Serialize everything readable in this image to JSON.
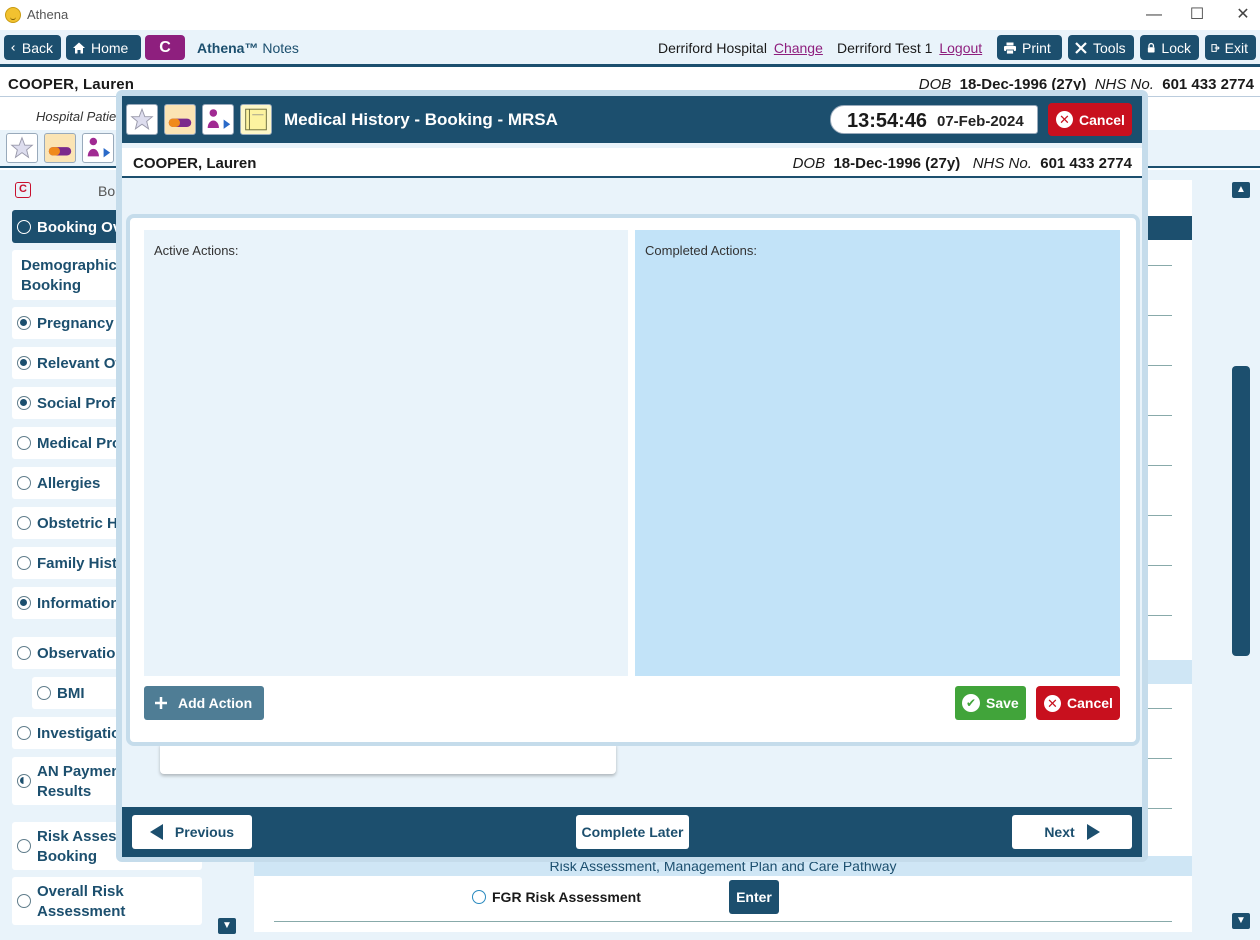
{
  "window": {
    "title": "Athena"
  },
  "toolbar": {
    "back": "Back",
    "home": "Home",
    "c_label": "C",
    "brand_bold": "Athena™",
    "brand_rest": " Notes",
    "hospital": "Derriford Hospital",
    "change": "Change",
    "user": "Derriford Test 1",
    "logout": "Logout",
    "print": "Print",
    "tools": "Tools",
    "lock": "Lock",
    "exit": "Exit"
  },
  "patient": {
    "name": "COOPER, Lauren",
    "dob_label": "DOB",
    "dob": "18-Dec-1996 (27y)",
    "nhs_label": "NHS No.",
    "nhs": "601 433 2774"
  },
  "subbar": {
    "label": "Hospital Patie"
  },
  "sidebar": {
    "header_text": "Bo",
    "items": [
      {
        "label": "Booking Ov",
        "state": "active"
      },
      {
        "label": "Demographics",
        "label2": "Booking",
        "state": "none"
      },
      {
        "label": "Pregnancy P",
        "state": "filled"
      },
      {
        "label": "Relevant Oth",
        "state": "filled"
      },
      {
        "label": "Social Profil",
        "state": "filled"
      },
      {
        "label": "Medical Pro",
        "state": "empty"
      },
      {
        "label": "Allergies",
        "state": "empty"
      },
      {
        "label": "Obstetric Hi",
        "state": "empty"
      },
      {
        "label": "Family Histo",
        "state": "empty"
      },
      {
        "label": "Information",
        "state": "filled"
      },
      {
        "label": "Observation",
        "state": "empty"
      },
      {
        "label": "BMI",
        "state": "empty"
      },
      {
        "label": "Investigation",
        "state": "empty"
      },
      {
        "label": "AN Paymen",
        "label2": "Results",
        "state": "half"
      },
      {
        "label": "Risk Assess",
        "label2": "Booking",
        "state": "empty"
      },
      {
        "label": "Overall Risk",
        "label2": "Assessment",
        "state": "empty"
      }
    ]
  },
  "background": {
    "risk_header": "Risk Assessment, Management Plan and Care Pathway",
    "fgr_label": "FGR Risk Assessment",
    "enter": "Enter"
  },
  "modal": {
    "title": "Medical History - Booking - MRSA",
    "time": "13:54:46",
    "date": "07-Feb-2024",
    "cancel": "Cancel",
    "active_actions": "Active Actions:",
    "completed_actions": "Completed Actions:",
    "add_action": "Add Action",
    "save": "Save",
    "previous": "Previous",
    "complete_later": "Complete Later",
    "next": "Next"
  },
  "colors": {
    "primary": "#1c4f6e",
    "accent_purple": "#8e1f7e",
    "danger": "#c8101e",
    "success": "#41a43a",
    "panel_light": "#e9f3fa",
    "panel_blue": "#c2e3f8"
  },
  "icons": [
    "app-icon",
    "back-chevron-icon",
    "home-icon",
    "print-icon",
    "tools-icon",
    "lock-icon",
    "exit-icon",
    "star-icon",
    "pill-icon",
    "person-arrow-icon",
    "notes-icon",
    "x-circle-icon",
    "check-circle-icon",
    "plus-icon",
    "arrow-left-icon",
    "arrow-right-icon"
  ]
}
